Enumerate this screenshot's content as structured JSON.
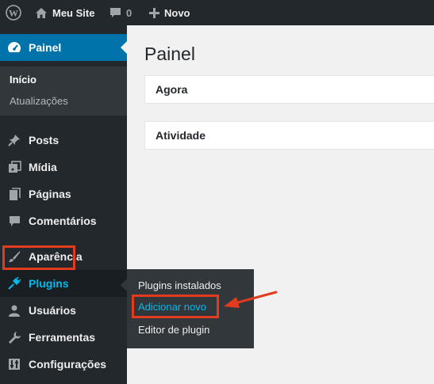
{
  "admin_bar": {
    "site_name": "Meu Site",
    "comments_count": "0",
    "new_label": "Novo"
  },
  "sidebar": {
    "dashboard_label": "Painel",
    "dashboard_submenu": [
      "Início",
      "Atualizações"
    ],
    "items": [
      {
        "label": "Posts",
        "icon": "pushpin-icon"
      },
      {
        "label": "Mídia",
        "icon": "media-icon"
      },
      {
        "label": "Páginas",
        "icon": "pages-icon"
      },
      {
        "label": "Comentários",
        "icon": "comments-icon"
      },
      {
        "label": "Aparência",
        "icon": "brush-icon"
      },
      {
        "label": "Plugins",
        "icon": "plugin-icon"
      },
      {
        "label": "Usuários",
        "icon": "user-icon"
      },
      {
        "label": "Ferramentas",
        "icon": "wrench-icon"
      },
      {
        "label": "Configurações",
        "icon": "settings-icon"
      }
    ]
  },
  "plugins_flyout": {
    "items": [
      "Plugins instalados",
      "Adicionar novo",
      "Editor de plugin"
    ]
  },
  "main": {
    "page_title": "Painel",
    "boxes": [
      "Agora",
      "Atividade"
    ]
  },
  "colors": {
    "admin_dark": "#23282d",
    "accent_blue": "#0073aa",
    "highlight_red": "#e23b1e",
    "link_blue": "#00b9eb"
  }
}
